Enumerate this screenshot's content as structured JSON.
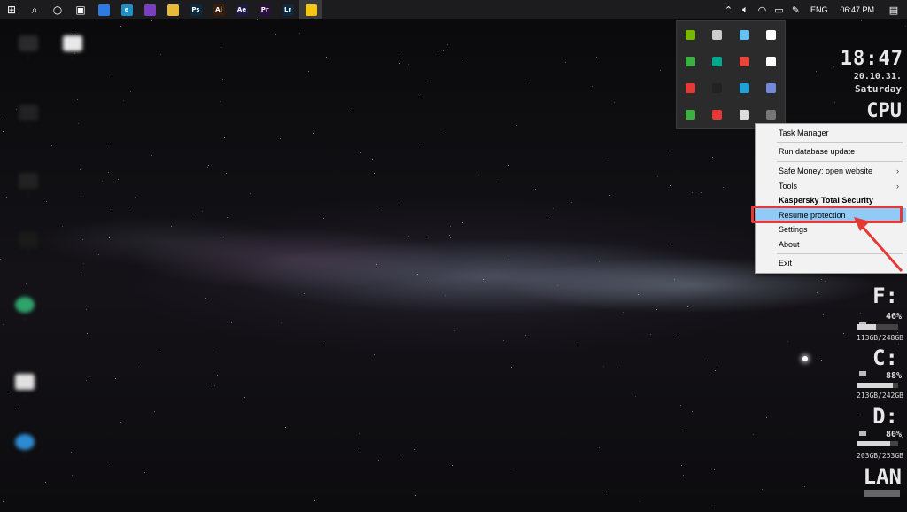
{
  "taskbar": {
    "apps": [
      {
        "name": "start-icon",
        "glyph": "⊞",
        "color": "#ffffff"
      },
      {
        "name": "search-icon",
        "glyph": "⌕",
        "color": "#ffffff"
      },
      {
        "name": "cortana-icon",
        "glyph": "○",
        "color": "#ffffff"
      },
      {
        "name": "task-view-icon",
        "glyph": "▣",
        "color": "#ffffff"
      },
      {
        "name": "pinned-app-blue-icon",
        "glyph": "",
        "color": "#2d7be0"
      },
      {
        "name": "edge-icon",
        "glyph": "e",
        "color": "#1e90c8"
      },
      {
        "name": "tor-browser-icon",
        "glyph": "",
        "color": "#7a3fbf"
      },
      {
        "name": "file-explorer-icon",
        "glyph": "",
        "color": "#e8b83a"
      },
      {
        "name": "photoshop-icon",
        "glyph": "Ps",
        "color": "#0b2a3f"
      },
      {
        "name": "illustrator-icon",
        "glyph": "Ai",
        "color": "#3b1c05"
      },
      {
        "name": "after-effects-icon",
        "glyph": "Ae",
        "color": "#1d1a4a"
      },
      {
        "name": "premiere-icon",
        "glyph": "Pr",
        "color": "#2a0f3f"
      },
      {
        "name": "lightroom-icon",
        "glyph": "Lr",
        "color": "#0d2a40"
      },
      {
        "name": "sticky-notes-icon",
        "glyph": "",
        "color": "#f5c518"
      }
    ],
    "language": "ENG",
    "time": "06:47 PM"
  },
  "tray_popup": {
    "icons": [
      {
        "name": "nvidia-icon",
        "color": "#76b900"
      },
      {
        "name": "usb-drive-icon",
        "color": "#cccccc"
      },
      {
        "name": "steam-icon",
        "color": "#66c0f4"
      },
      {
        "name": "drop-icon",
        "color": "#ffffff"
      },
      {
        "name": "camera-icon",
        "color": "#3cb043"
      },
      {
        "name": "kaspersky-shield-icon",
        "color": "#00a88e"
      },
      {
        "name": "s-app-icon",
        "color": "#e8453c"
      },
      {
        "name": "g-app-icon",
        "color": "#ffffff"
      },
      {
        "name": "pin-app-icon",
        "color": "#e53935"
      },
      {
        "name": "bitdefender-icon",
        "color": "#222222"
      },
      {
        "name": "dots-app-icon",
        "color": "#1fa2d9"
      },
      {
        "name": "discord-icon",
        "color": "#7289da"
      },
      {
        "name": "wifi-app-icon",
        "color": "#3cb043"
      },
      {
        "name": "download-app-icon",
        "color": "#e53935"
      },
      {
        "name": "printer-app-icon",
        "color": "#dddddd"
      },
      {
        "name": "kaspersky-gray-shield-icon",
        "color": "#777777"
      }
    ]
  },
  "context_menu": {
    "task_manager": "Task Manager",
    "run_database_update": "Run database update",
    "safe_money": "Safe Money: open website",
    "tools": "Tools",
    "product_name": "Kaspersky Total Security",
    "resume_protection": "Resume protection",
    "settings": "Settings",
    "about": "About",
    "exit": "Exit",
    "submenu_arrow": "›"
  },
  "rainmeter": {
    "time": "18:47",
    "date": "20.10.31.",
    "day": "Saturday",
    "cpu": "CPU",
    "drives": [
      {
        "letter": "F:",
        "percent": "46%",
        "usage_fraction": 0.46,
        "size": "113GB/248GB"
      },
      {
        "letter": "C:",
        "percent": "88%",
        "usage_fraction": 0.88,
        "size": "213GB/242GB"
      },
      {
        "letter": "D:",
        "percent": "80%",
        "usage_fraction": 0.8,
        "size": "203GB/253GB"
      }
    ],
    "lan": "LAN"
  }
}
